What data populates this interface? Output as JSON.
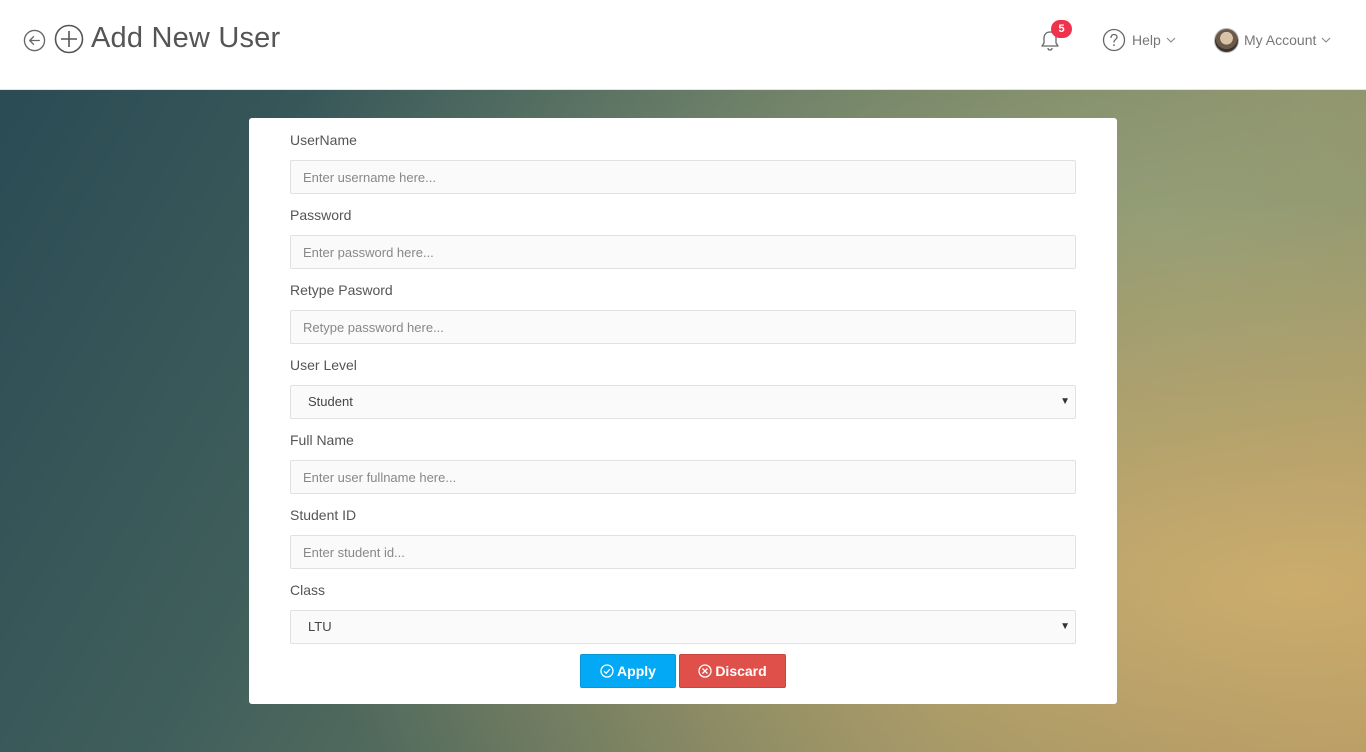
{
  "header": {
    "title": "Add New User",
    "notification_count": "5",
    "help_label": "Help",
    "account_label": "My Account",
    "icons": [
      "back-arrow-icon",
      "plus-circle-icon",
      "bell-icon",
      "question-circle-icon",
      "chevron-down-icon"
    ]
  },
  "form": {
    "username": {
      "label": "UserName",
      "placeholder": "Enter username here..."
    },
    "password": {
      "label": "Password",
      "placeholder": "Enter password here..."
    },
    "retype_password": {
      "label": "Retype Pasword",
      "placeholder": "Retype password here..."
    },
    "user_level": {
      "label": "User Level",
      "value": "Student"
    },
    "full_name": {
      "label": "Full Name",
      "placeholder": "Enter user fullname here..."
    },
    "student_id": {
      "label": "Student ID",
      "placeholder": "Enter student id..."
    },
    "class": {
      "label": "Class",
      "value": "LTU"
    }
  },
  "actions": {
    "apply_label": "Apply",
    "discard_label": "Discard"
  },
  "colors": {
    "apply": "#03a9f4",
    "discard": "#e0504a",
    "badge": "#f0334d"
  }
}
